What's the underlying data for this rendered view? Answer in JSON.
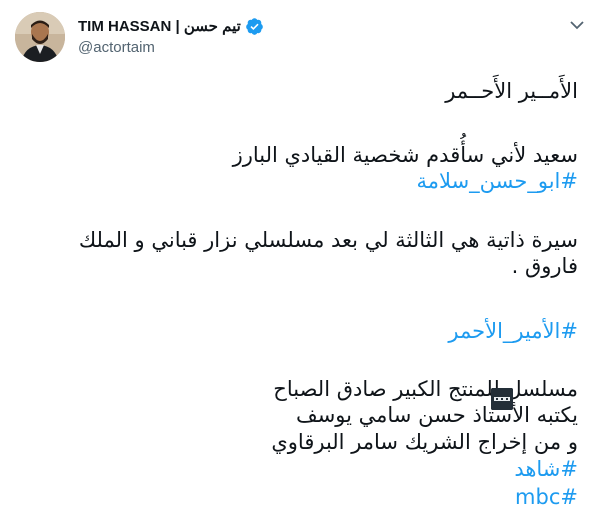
{
  "author": {
    "display_name": "TIM HASSAN | تيم حسن",
    "handle": "@actortaim",
    "verified": true,
    "verified_color": "#1d9bf0"
  },
  "tweet": {
    "line1": "الأَمــير الأَحــمر",
    "line2": "سعيد لأني سأُقدم شخصية القيادي البارز",
    "line3": "#ابو_حسن_سلامة",
    "line4": "سيرة ذاتية هي الثالثة لي بعد مسلسلي نزار قباني و الملك",
    "line5": "فاروق .",
    "line6": "#الأمير_الأحمر",
    "line7": "مسلسل للمنتج الكبير صادق الصباح",
    "line8": "يكتبه الأستاذ حسن سامي يوسف",
    "line9": "و من إخراج الشريك سامر البرقاوي",
    "line10": "#شاهد",
    "line11": "#mbc",
    "hashtag_color": "#1d9bf0"
  },
  "emoji": {
    "shahid_logo": "shahid-logo-icon"
  }
}
